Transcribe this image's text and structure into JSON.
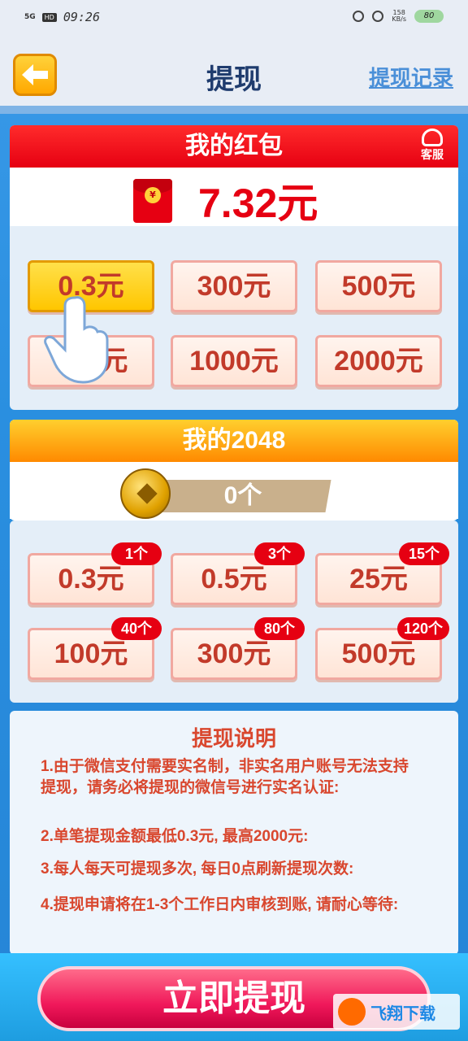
{
  "status_bar": {
    "signal": "5G",
    "hd": "HD",
    "time": "09:26",
    "net_speed": "158\nKB/s",
    "battery": "80"
  },
  "header": {
    "title": "提现",
    "history_link": "提现记录"
  },
  "red_packet": {
    "title": "我的红包",
    "customer_service": "客服",
    "envelope_symbol": "¥",
    "balance": "7.32元",
    "options": [
      "0.3元",
      "300元",
      "500元",
      "800元",
      "1000元",
      "2000元"
    ],
    "selected_index": 0
  },
  "game": {
    "title": "我的2048",
    "coin_count": "0个",
    "options": [
      {
        "label": "0.3元",
        "cost": "1个"
      },
      {
        "label": "0.5元",
        "cost": "3个"
      },
      {
        "label": "25元",
        "cost": "15个"
      },
      {
        "label": "100元",
        "cost": "40个"
      },
      {
        "label": "300元",
        "cost": "80个"
      },
      {
        "label": "500元",
        "cost": "120个"
      }
    ]
  },
  "notes": {
    "title": "提现说明",
    "items": [
      "1.由于微信支付需要实名制，非实名用户账号无法支持提现，请务必将提现的微信号进行实名认证:",
      "2.单笔提现金额最低0.3元, 最高2000元:",
      "3.每人每天可提现多次, 每日0点刷新提现次数:",
      "4.提现申请将在1-3个工作日内审核到账, 请耐心等待:"
    ]
  },
  "footer": {
    "withdraw_button": "立即提现",
    "watermark": "飞翔下载"
  }
}
